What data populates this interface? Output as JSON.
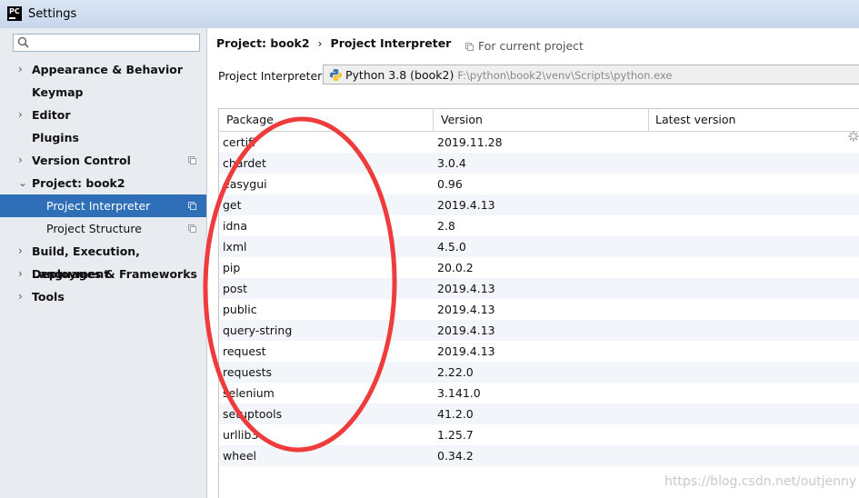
{
  "window": {
    "title": "Settings"
  },
  "sidebar": {
    "search_placeholder": "",
    "items": [
      {
        "label": "Appearance & Behavior",
        "chevron": "›"
      },
      {
        "label": "Keymap",
        "chevron": ""
      },
      {
        "label": "Editor",
        "chevron": "›"
      },
      {
        "label": "Plugins",
        "chevron": ""
      },
      {
        "label": "Version Control",
        "chevron": "›"
      },
      {
        "label": "Project: book2",
        "chevron": "⌄"
      },
      {
        "label": "Project Interpreter",
        "chevron": ""
      },
      {
        "label": "Project Structure",
        "chevron": ""
      },
      {
        "label": "Build, Execution, Deployment",
        "chevron": "›"
      },
      {
        "label": "Languages & Frameworks",
        "chevron": "›"
      },
      {
        "label": "Tools",
        "chevron": "›"
      }
    ]
  },
  "breadcrumb": {
    "project": "Project: book2",
    "separator": "›",
    "page": "Project Interpreter",
    "scope": "For current project"
  },
  "interpreter": {
    "label": "Project Interpreter:",
    "name": "Python 3.8 (book2)",
    "path": "F:\\python\\book2\\venv\\Scripts\\python.exe",
    "dropdown_glyph": "▾"
  },
  "table": {
    "columns": [
      "Package",
      "Version",
      "Latest version"
    ],
    "rows": [
      {
        "package": "certifi",
        "version": "2019.11.28"
      },
      {
        "package": "chardet",
        "version": "3.0.4"
      },
      {
        "package": "easygui",
        "version": "0.96"
      },
      {
        "package": "get",
        "version": "2019.4.13"
      },
      {
        "package": "idna",
        "version": "2.8"
      },
      {
        "package": "lxml",
        "version": "4.5.0"
      },
      {
        "package": "pip",
        "version": "20.0.2"
      },
      {
        "package": "post",
        "version": "2019.4.13"
      },
      {
        "package": "public",
        "version": "2019.4.13"
      },
      {
        "package": "query-string",
        "version": "2019.4.13"
      },
      {
        "package": "request",
        "version": "2019.4.13"
      },
      {
        "package": "requests",
        "version": "2.22.0"
      },
      {
        "package": "selenium",
        "version": "3.141.0"
      },
      {
        "package": "setuptools",
        "version": "41.2.0"
      },
      {
        "package": "urllib3",
        "version": "1.25.7"
      },
      {
        "package": "wheel",
        "version": "0.34.2"
      }
    ]
  },
  "annotation": {
    "color": "#ee3b3b"
  },
  "watermark": "https://blog.csdn.net/outjenny",
  "colors": {
    "selection": "#2f6fb7",
    "sidebar_bg": "#e8ecf1"
  }
}
